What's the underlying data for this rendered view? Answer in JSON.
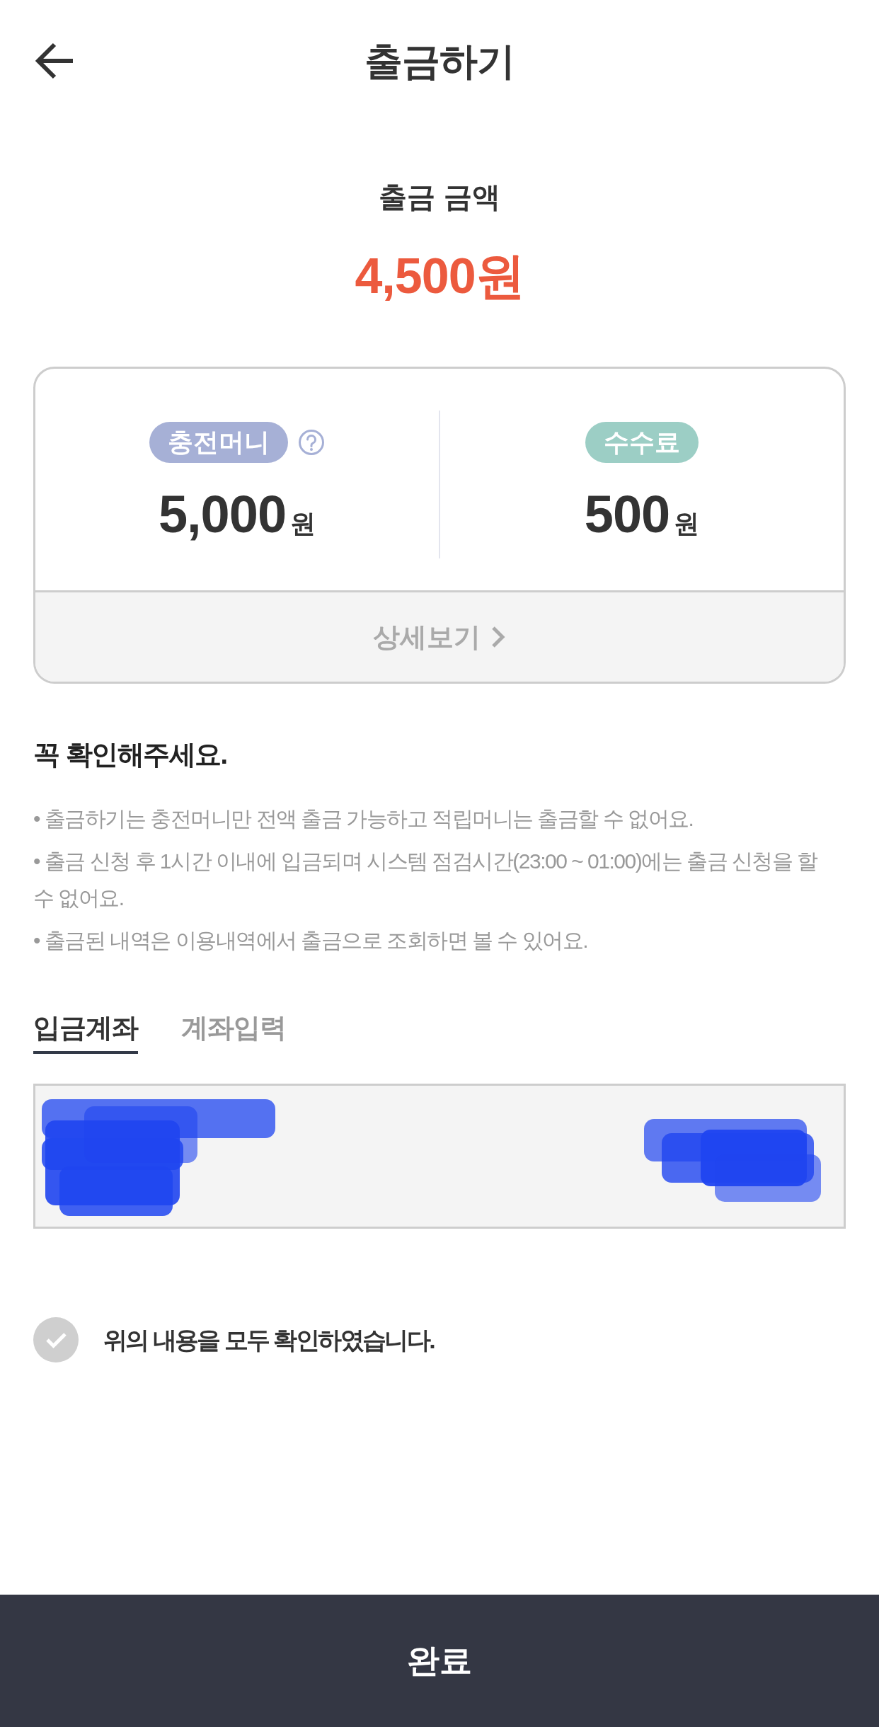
{
  "header": {
    "title": "출금하기"
  },
  "withdraw_amount": {
    "label": "출금 금액",
    "value": "4,500원"
  },
  "summary": {
    "items": [
      {
        "label": "충전머니",
        "help": true,
        "amount": "5,000",
        "unit": "원",
        "color": "#a6b0d6"
      },
      {
        "label": "수수료",
        "help": false,
        "amount": "500",
        "unit": "원",
        "color": "#9ccec5"
      }
    ],
    "details_link": "상세보기"
  },
  "notice": {
    "title": "꼭 확인해주세요.",
    "items": [
      "• 출금하기는 충전머니만 전액 출금 가능하고 적립머니는 출금할 수 없어요.",
      "• 출금 신청 후 1시간 이내에 입금되며 시스템 점검시간(23:00 ~ 01:00)에는 출금 신청을 할 수 없어요.",
      "• 출금된 내역은 이용내역에서 출금으로 조회하면 볼 수 있어요."
    ]
  },
  "deposit_tabs": [
    {
      "label": "입금계좌",
      "selected": true
    },
    {
      "label": "계좌입력",
      "selected": false
    }
  ],
  "account_box": {
    "redacted": true
  },
  "agreement": {
    "label": "위의 내용을 모두 확인하였습니다.",
    "checked": false
  },
  "complete_button": "완료"
}
